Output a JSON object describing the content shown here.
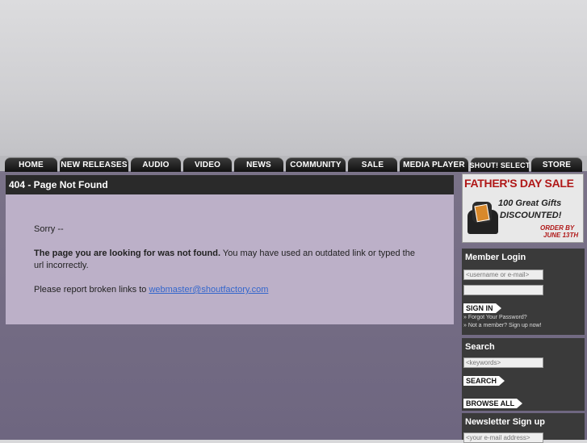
{
  "nav": {
    "items": [
      "HOME",
      "NEW RELEASES",
      "AUDIO",
      "VIDEO",
      "NEWS",
      "COMMUNITY",
      "SALE",
      "MEDIA PLAYER",
      "SHOUT! SELECT",
      "STORE"
    ]
  },
  "main": {
    "title": "404 - Page Not Found",
    "sorry": "Sorry --",
    "bold_line": "The page you are looking for was not found.",
    "rest_line": " You may have used an outdated link or typed the url incorrectly.",
    "report_text": "Please report broken links to ",
    "email": "webmaster@shoutfactory.com"
  },
  "promo": {
    "line1": "FATHER'S DAY SALE",
    "line2": "100 Great Gifts",
    "line3": "DISCOUNTED!",
    "line4": "ORDER BY",
    "line5": "JUNE 13TH"
  },
  "login": {
    "title": "Member Login",
    "username_placeholder": "<username or e-mail>",
    "sign_in": "SIGN IN",
    "forgot": "» Forgot Your Password?",
    "not_member": "» Not a member? Sign up now!"
  },
  "search": {
    "title": "Search",
    "keywords_placeholder": "<keywords>",
    "search_btn": "SEARCH",
    "browse_btn": "BROWSE ALL"
  },
  "newsletter": {
    "title": "Newsletter Sign up",
    "email_placeholder": "<your e-mail address>"
  },
  "colors": {
    "nav_tab": "#1a1a1a",
    "panel_bg": "#bcb0c8",
    "link": "#3366cc",
    "promo_red": "#c41a1a"
  }
}
